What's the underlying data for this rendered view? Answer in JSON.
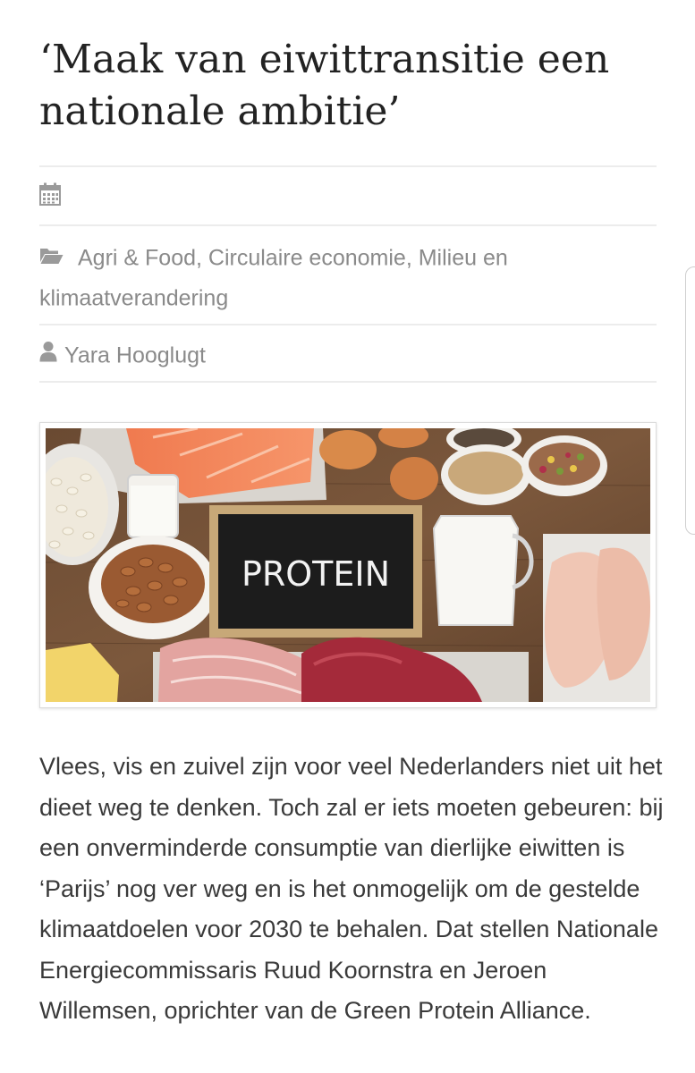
{
  "article": {
    "title": "‘Maak van eiwittransitie een nationale ambitie’",
    "meta": {
      "date_icon": "calendar-icon",
      "categories_icon": "folder-open-icon",
      "categories": "Agri & Food, Circulaire economie, Milieu en klimaatverandering",
      "author_icon": "user-icon",
      "author": "Yara Hooglugt"
    },
    "image": {
      "chalkboard_text": "PROTEIN"
    },
    "body": "Vlees, vis en zuivel zijn voor veel Nederlanders niet uit het dieet weg te denken. Toch zal er iets moeten gebeuren: bij een onverminderde consumptie van dierlijke eiwitten is ‘Parijs’ nog ver weg en is het onmogelijk om de gestelde klimaatdoelen voor 2030 te behalen. Dat stellen Nationale Energiecommissaris Ruud Koornstra en Jeroen Willemsen, oprichter van de Green Protein Alliance."
  },
  "colors": {
    "title": "#222222",
    "meta_text": "#8a8a8a",
    "body_text": "#3a3a3a",
    "divider": "#ececec"
  }
}
